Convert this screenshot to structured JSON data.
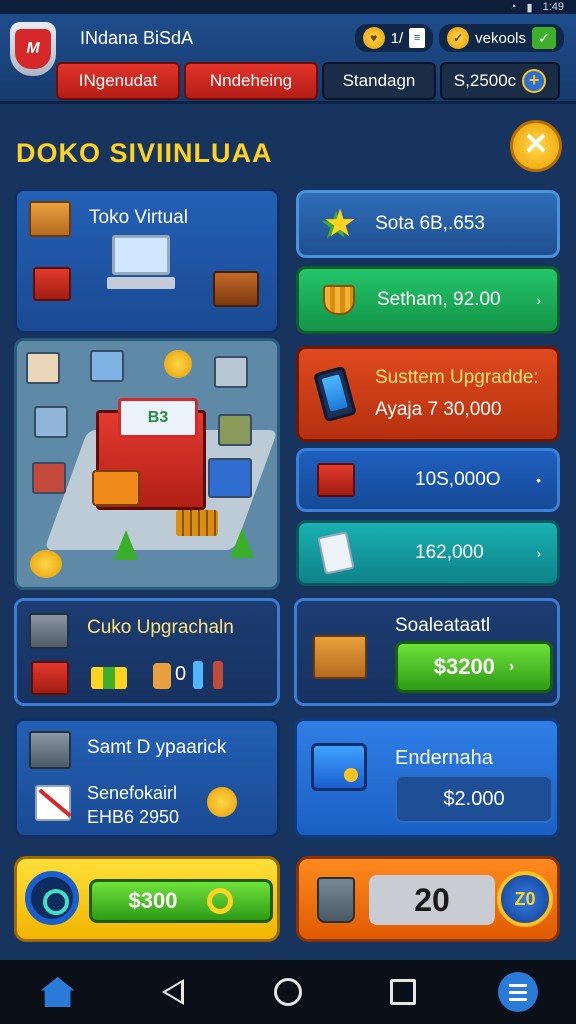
{
  "status_bar": {
    "time": "1:49"
  },
  "header": {
    "logo_text": "M",
    "app_title": "INdana BiSdA",
    "currency_primary": "1/",
    "currency_secondary": "vekools",
    "tabs": [
      {
        "label": "INgenudat"
      },
      {
        "label": "Nndeheing"
      },
      {
        "label": "Standagn"
      },
      {
        "label": "S,2500c"
      }
    ]
  },
  "page": {
    "title": "DOKO SIVIINLUAA"
  },
  "left_panels": {
    "toko_virtual": {
      "title": "Toko Virtual"
    },
    "upgrade": {
      "title": "Cuko Upgrachaln",
      "counter": "0"
    },
    "saat_upgrade": {
      "title": "Samt D ypaarick",
      "subtitle": "Senefokairl",
      "price": "EHB6 2950"
    }
  },
  "right_rows": [
    {
      "label": "Sota 6B,.653",
      "arrow": ""
    },
    {
      "label": "Setham, 92.00",
      "arrow": "›"
    },
    {
      "label": "Susttem Upgradde:",
      "sub": "Ayaja 7 30,000"
    },
    {
      "label": "10S,000O",
      "arrow": "•"
    },
    {
      "label": "162,000",
      "arrow": "›"
    }
  ],
  "right_panels": {
    "sale": {
      "title": "Soaleataatl",
      "button": "$3200",
      "arrow": "›"
    },
    "endernaha": {
      "title": "Endernaha",
      "price": "$2.000"
    }
  },
  "scene": {
    "sign_text": "B3"
  },
  "bottom": {
    "left_button": "$300",
    "right_value": "20",
    "badge": "Z0"
  },
  "colors": {
    "accent": "#ffd21f",
    "primary": "#1f4d8c",
    "danger": "#d62828",
    "success": "#3fae2a"
  }
}
